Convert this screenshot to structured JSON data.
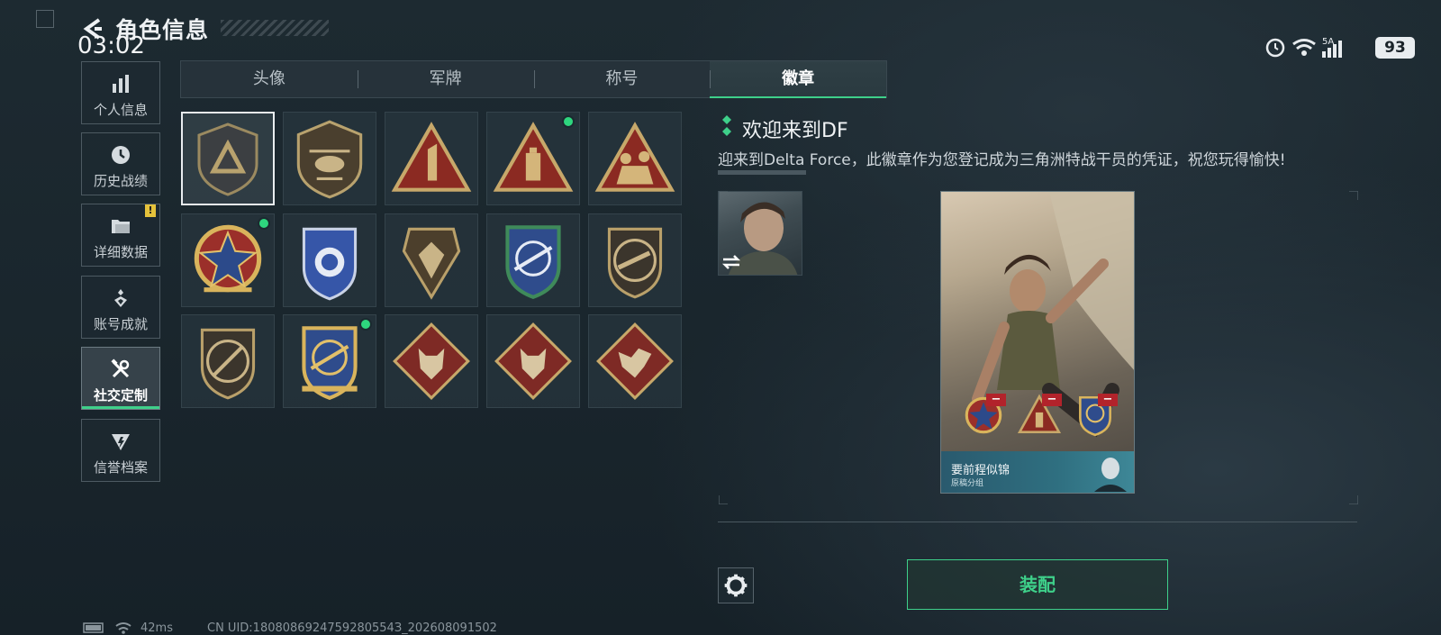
{
  "header": {
    "title": "角色信息",
    "time": "03:02",
    "network_label": "5A",
    "battery": "93"
  },
  "nav": [
    {
      "label": "个人信息",
      "icon": "bar-chart-icon"
    },
    {
      "label": "历史战绩",
      "icon": "clock-icon"
    },
    {
      "label": "详细数据",
      "icon": "folder-icon",
      "alert": "!"
    },
    {
      "label": "账号成就",
      "icon": "medal-icon"
    },
    {
      "label": "社交定制",
      "icon": "tools-icon",
      "active": true
    },
    {
      "label": "信誉档案",
      "icon": "shield-icon"
    }
  ],
  "tabs": [
    {
      "label": "头像"
    },
    {
      "label": "军牌"
    },
    {
      "label": "称号"
    },
    {
      "label": "徽章",
      "active": true
    }
  ],
  "badges": [
    {
      "icon": "delta-triangle-badge-icon",
      "selected": true
    },
    {
      "icon": "helicopter-badge-icon"
    },
    {
      "icon": "number-one-triangle-badge-icon"
    },
    {
      "icon": "usb-triangle-badge-icon",
      "equipped": true
    },
    {
      "icon": "soldiers-triangle-badge-icon"
    },
    {
      "icon": "star-medal-badge-icon",
      "equipped": true
    },
    {
      "icon": "blue-police-badge-icon"
    },
    {
      "icon": "gem-shield-badge-icon"
    },
    {
      "icon": "crosshair-rifle-blue-badge-icon"
    },
    {
      "icon": "rifle-round-badge-icon"
    },
    {
      "icon": "sniper-round-badge-icon"
    },
    {
      "icon": "crosshair-rifle-gold-badge-icon",
      "equipped": true
    },
    {
      "icon": "wolf-diamond-badge-icon"
    },
    {
      "icon": "wolf-diamond-badge-icon"
    },
    {
      "icon": "dragon-diamond-badge-icon"
    }
  ],
  "detail": {
    "title": "欢迎来到DF",
    "description": "迎来到Delta Force，此徽章作为您登记成为三角洲特战干员的凭证，祝您玩得愉快!"
  },
  "card": {
    "name": "要前程似锦",
    "subtitle": "原稿分组"
  },
  "actions": {
    "equip_label": "装配"
  },
  "footer": {
    "ping": "42ms",
    "uid": "CN UID:1808086924759280554З_202608091502"
  },
  "colors": {
    "accent": "#3ed08a",
    "alert": "#e5c23b",
    "remove": "#b2232b"
  }
}
